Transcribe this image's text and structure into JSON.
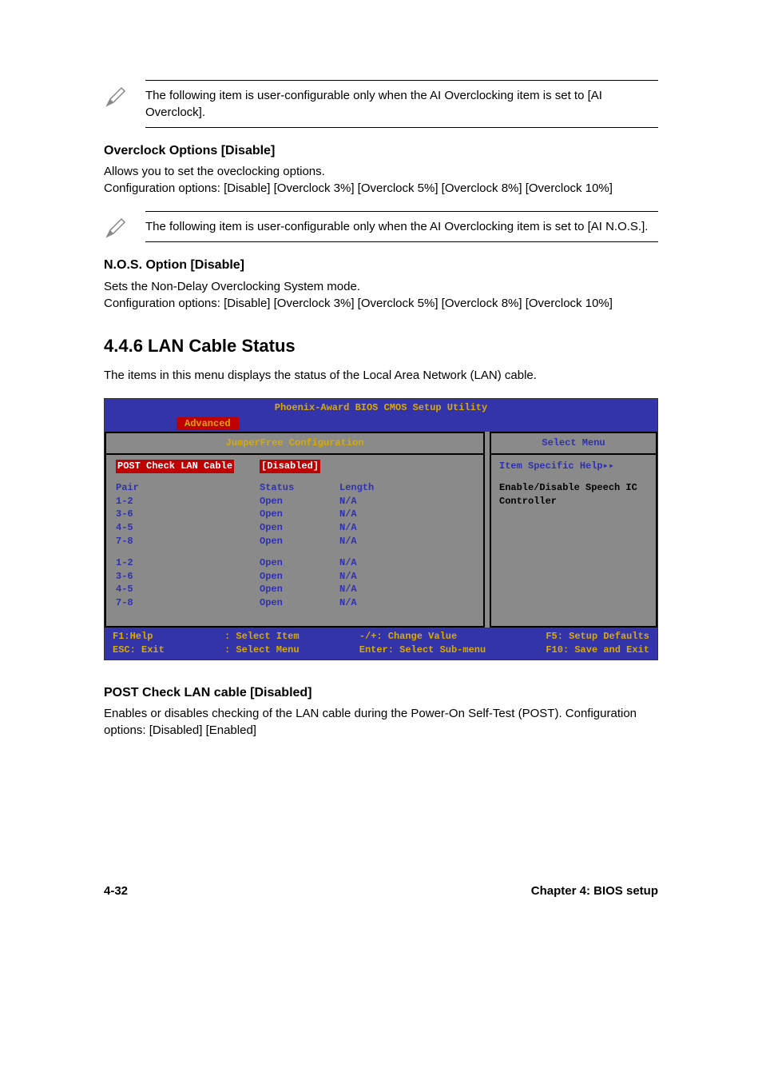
{
  "note1": "The following item is user-configurable only when the AI Overclocking item is set to [AI Overclock].",
  "section1": {
    "title": "Overclock Options [Disable]",
    "line1": "Allows you to set the oveclocking options.",
    "line2": "Configuration options: [Disable] [Overclock 3%] [Overclock 5%] [Overclock 8%] [Overclock 10%]"
  },
  "note2": "The following item is user-configurable only when the AI Overclocking item is set to [AI N.O.S.].",
  "section2": {
    "title": "N.O.S. Option [Disable]",
    "line1": "Sets the Non-Delay Overclocking System mode.",
    "line2": "Configuration options: [Disable] [Overclock 3%] [Overclock 5%] [Overclock 8%] [Overclock 10%]"
  },
  "section3": {
    "title": "4.4.6   LAN Cable Status",
    "desc": "The items in this menu displays the status of the Local Area Network (LAN) cable."
  },
  "bios": {
    "title": "Phoenix-Award BIOS CMOS Setup Utility",
    "tab": "Advanced",
    "leftTitle": "JumperFree Configuration",
    "rightTitle": "Select Menu",
    "highlightLabel": "POST Check LAN Cable",
    "highlightValue": "[Disabled]",
    "headerRow": {
      "c1": "Pair",
      "c2": "Status",
      "c3": "Length"
    },
    "rows1": [
      {
        "c1": "1-2",
        "c2": "Open",
        "c3": "N/A"
      },
      {
        "c1": "3-6",
        "c2": "Open",
        "c3": "N/A"
      },
      {
        "c1": "4-5",
        "c2": "Open",
        "c3": "N/A"
      },
      {
        "c1": "7-8",
        "c2": "Open",
        "c3": "N/A"
      }
    ],
    "rows2": [
      {
        "c1": "1-2",
        "c2": "Open",
        "c3": "N/A"
      },
      {
        "c1": "3-6",
        "c2": "Open",
        "c3": "N/A"
      },
      {
        "c1": "4-5",
        "c2": "Open",
        "c3": "N/A"
      },
      {
        "c1": "7-8",
        "c2": "Open",
        "c3": "N/A"
      }
    ],
    "helpHeader": "Item Specific Help▸▸",
    "helpText": "Enable/Disable Speech IC Controller",
    "footer": {
      "l1": "F1:Help",
      "l2": "ESC: Exit",
      "m1a": ": Select Item",
      "m1b": ": Select Menu",
      "m2a": "-/+: Change Value",
      "m2b": "Enter: Select Sub-menu",
      "r1": "F5: Setup Defaults",
      "r2": "F10: Save and Exit"
    }
  },
  "section4": {
    "title": "POST Check LAN cable [Disabled]",
    "desc": "Enables or disables checking of the LAN cable during the Power-On Self-Test (POST). Configuration options: [Disabled] [Enabled]"
  },
  "footer": {
    "left": "4-32",
    "right": "Chapter 4: BIOS setup"
  }
}
